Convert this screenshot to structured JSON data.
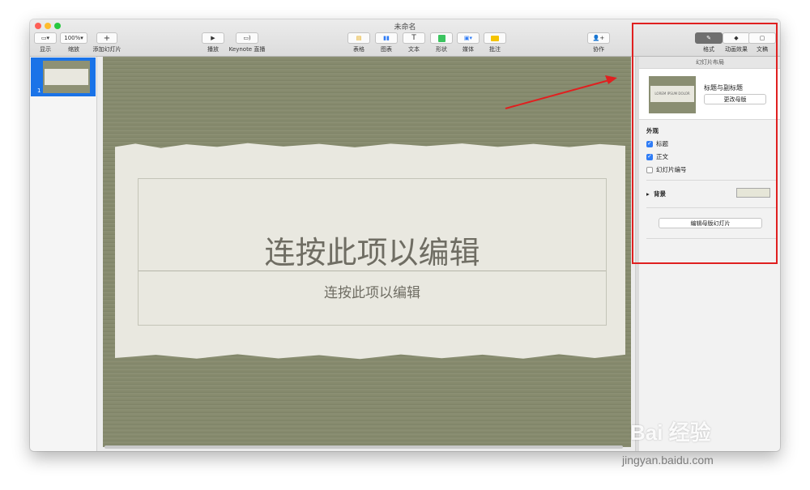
{
  "window": {
    "title": "未命名"
  },
  "toolbar": {
    "view": {
      "label": "显示"
    },
    "zoom": {
      "value": "100%",
      "label": "缩放"
    },
    "add_slide": {
      "label": "添加幻灯片"
    },
    "play": {
      "label": "播放"
    },
    "keynote_live": {
      "label": "Keynote 直播"
    },
    "table": {
      "label": "表格"
    },
    "chart": {
      "label": "图表"
    },
    "text": {
      "label": "文本"
    },
    "shape": {
      "label": "形状"
    },
    "media": {
      "label": "媒体"
    },
    "comment": {
      "label": "批注"
    },
    "collaborate": {
      "label": "协作"
    },
    "format": {
      "label": "格式"
    },
    "animate": {
      "label": "动画效果"
    },
    "document": {
      "label": "文稿"
    }
  },
  "navigator": {
    "slides": [
      {
        "number": "1"
      }
    ]
  },
  "slide": {
    "title": "连按此项以编辑",
    "subtitle": "连按此项以编辑"
  },
  "inspector": {
    "header": "幻灯片布局",
    "layout_name": "标题与副标题",
    "change_master": "更改母版",
    "thumb_text": "LOREM IPSUM DOLOR",
    "appearance": {
      "title": "外观",
      "title_checkbox": {
        "label": "标题",
        "checked": true
      },
      "body_checkbox": {
        "label": "正文",
        "checked": true
      },
      "slide_number_checkbox": {
        "label": "幻灯片编号",
        "checked": false
      }
    },
    "background": {
      "label": "背景",
      "color": "#e6e6d8"
    },
    "edit_master": "编辑母版幻灯片"
  },
  "annotation": {
    "color": "#e02020"
  },
  "watermark": {
    "logo": "Bai 经验",
    "url": "jingyan.baidu.com"
  }
}
